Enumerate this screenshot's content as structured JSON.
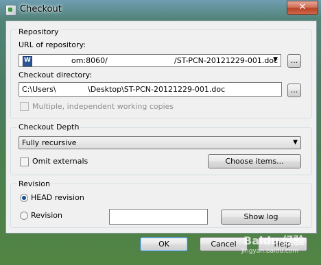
{
  "window": {
    "title": "Checkout",
    "close_label": "✕"
  },
  "repository": {
    "group_label": "Repository",
    "url_label": "URL of repository:",
    "url_value_start": "om:8060/",
    "url_value_end": "/ST-PCN-20121229-001.doc",
    "browse_label": "...",
    "dir_label": "Checkout directory:",
    "dir_value_start": "C:\\Users\\",
    "dir_value_end": "\\Desktop\\ST-PCN-20121229-001.doc",
    "browse2_label": "...",
    "multiple_label": "Multiple, independent working copies"
  },
  "depth": {
    "group_label": "Checkout Depth",
    "selected": "Fully recursive",
    "omit_label": "Omit externals",
    "choose_label": "Choose items..."
  },
  "revision": {
    "group_label": "Revision",
    "head_label": "HEAD revision",
    "rev_label": "Revision",
    "rev_value": "",
    "show_log_label": "Show log"
  },
  "footer": {
    "ok_label": "OK",
    "cancel_label": "Cancel",
    "help_label": "Help"
  },
  "watermark": {
    "main": "Baidu 经验",
    "sub": "jingyan.baidu.com"
  }
}
